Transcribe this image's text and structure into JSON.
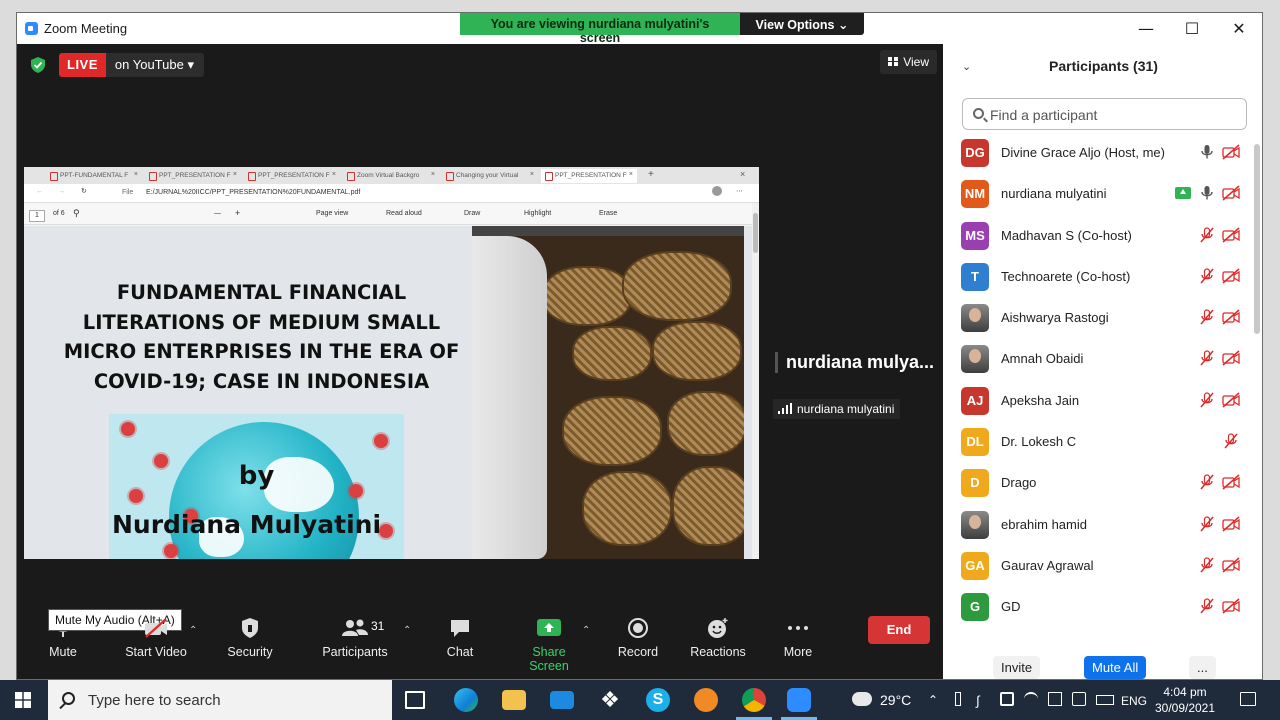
{
  "window": {
    "title": "Zoom Meeting",
    "banner_text": "You are viewing nurdiana mulyatini's screen",
    "view_options_label": "View Options ⌄"
  },
  "meeting": {
    "live_label": "LIVE",
    "stream_target": "on YouTube ▾",
    "view_label": "View"
  },
  "shared_screen": {
    "tabs": [
      "PPT-FUNDAMENTAL F",
      "PPT_PRESENTATION F",
      "PPT_PRESENTATION F",
      "Zoom Virtual Backgro",
      "Changing your Virtual",
      "PPT_PRESENTATION F"
    ],
    "url_prefix": "File",
    "url": "E:/JURNAL%20IICC/PPT_PRESENTATION%20FUNDAMENTAL.pdf",
    "page_number": "1",
    "page_total": "of 6",
    "tools": {
      "page_view": "Page view",
      "read_aloud": "Read aloud",
      "draw": "Draw",
      "highlight": "Highlight",
      "erase": "Erase"
    },
    "slide_title": "FUNDAMENTAL FINANCIAL LITERATIONS OF MEDIUM SMALL MICRO ENTERPRISES IN THE ERA OF COVID-19; CASE IN INDONESIA",
    "by_text": "by",
    "author": "Nurdiana Mulyatini"
  },
  "speaker": {
    "name_display": "nurdiana  mulya...",
    "name_tag": "nurdiana mulyatini"
  },
  "toolbar": {
    "mute": "Mute",
    "mute_tooltip": "Mute My Audio (Alt+A)",
    "start_video": "Start Video",
    "security": "Security",
    "participants": "Participants",
    "participant_count": "31",
    "chat": "Chat",
    "share_screen": "Share Screen",
    "record": "Record",
    "reactions": "Reactions",
    "more": "More",
    "end": "End"
  },
  "participants_panel": {
    "title": "Participants (31)",
    "search_placeholder": "Find a participant",
    "invite": "Invite",
    "mute_all": "Mute All",
    "more": "...",
    "list": [
      {
        "initials": "DG",
        "name": "Divine Grace Aljo (Host, me)",
        "color": "#c8372d",
        "mic": "on",
        "video": "off",
        "photo": false,
        "sharing": false
      },
      {
        "initials": "NM",
        "name": "nurdiana mulyatini",
        "color": "#e2591c",
        "mic": "on",
        "video": "off",
        "photo": false,
        "sharing": true
      },
      {
        "initials": "MS",
        "name": "Madhavan S (Co-host)",
        "color": "#9a3fb0",
        "mic": "muted",
        "video": "off",
        "photo": false,
        "sharing": false
      },
      {
        "initials": "T",
        "name": "Technoarete (Co-host)",
        "color": "#2f7fd0",
        "mic": "muted",
        "video": "off",
        "photo": false,
        "sharing": false
      },
      {
        "initials": "",
        "name": "Aishwarya Rastogi",
        "color": "#555555",
        "mic": "muted",
        "video": "off",
        "photo": true,
        "sharing": false
      },
      {
        "initials": "",
        "name": "Amnah Obaidi",
        "color": "#555555",
        "mic": "muted",
        "video": "off",
        "photo": true,
        "sharing": false
      },
      {
        "initials": "AJ",
        "name": "Apeksha Jain",
        "color": "#c8372d",
        "mic": "muted",
        "video": "off",
        "photo": false,
        "sharing": false
      },
      {
        "initials": "DL",
        "name": "Dr. Lokesh C",
        "color": "#f0a91c",
        "mic": "muted",
        "video": "none",
        "photo": false,
        "sharing": false
      },
      {
        "initials": "D",
        "name": "Drago",
        "color": "#f0a91c",
        "mic": "muted",
        "video": "off",
        "photo": false,
        "sharing": false
      },
      {
        "initials": "",
        "name": "ebrahim hamid",
        "color": "#555555",
        "mic": "muted",
        "video": "off",
        "photo": true,
        "sharing": false
      },
      {
        "initials": "GA",
        "name": "Gaurav Agrawal",
        "color": "#f0a91c",
        "mic": "muted",
        "video": "off",
        "photo": false,
        "sharing": false
      },
      {
        "initials": "G",
        "name": "GD",
        "color": "#2e9a3e",
        "mic": "muted",
        "video": "off",
        "photo": false,
        "sharing": false
      }
    ]
  },
  "taskbar": {
    "search_placeholder": "Type here to search",
    "temperature": "29°C",
    "language": "ENG",
    "time": "4:04 pm",
    "date": "30/09/2021"
  }
}
